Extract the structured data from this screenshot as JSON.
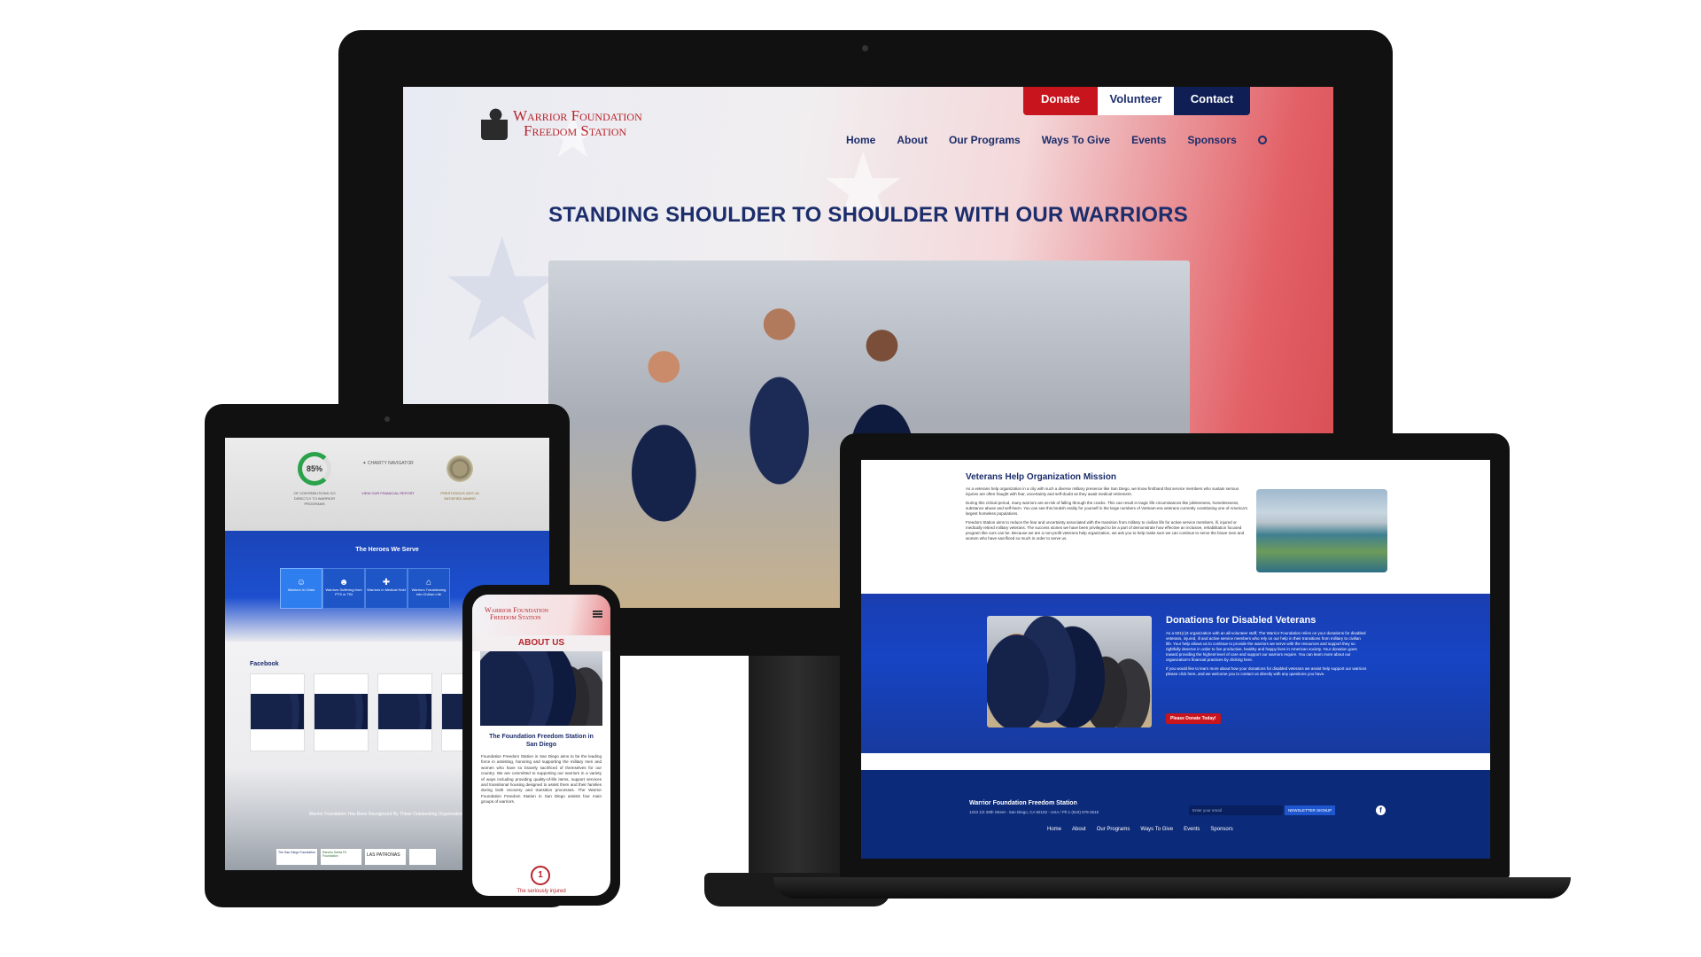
{
  "desktop": {
    "logo_line1": "Warrior Foundation",
    "logo_line2": "Freedom Station",
    "top_buttons": [
      "Donate",
      "Volunteer",
      "Contact"
    ],
    "nav": [
      "Home",
      "About",
      "Our Programs",
      "Ways To Give",
      "Events",
      "Sponsors"
    ],
    "hero_title": "STANDING SHOULDER TO SHOULDER WITH OUR WARRIORS"
  },
  "tablet": {
    "stat_percent": "85%",
    "stat1": "OF CONTRIBUTIONS GO DIRECTLY TO WARRIOR PROGRAMS",
    "stat2": "VIEW OUR FINANCIAL REPORT",
    "stat3": "PRESTIGIOUS 2007-16 SATISFIED AWARD",
    "charity_label": "CHARITY NAVIGATOR",
    "heroes_title": "The Heroes We Serve",
    "heroes_items": [
      "Warriors In Crisis",
      "Warriors Suffering from PTS or TBI",
      "Warriors in Medical Hold",
      "Warriors Transitioning into Civilian Life"
    ],
    "facebook_title": "Facebook",
    "recognized": "Warrior Foundation Has Been Recognized By These Outstanding Organizations",
    "sponsors": [
      "The San Diego Foundation",
      "Rancho Santa Fe Foundation",
      "LAS PATRONAS"
    ]
  },
  "phone": {
    "logo_line1": "Warrior Foundation",
    "logo_line2": "Freedom Station",
    "about_title": "ABOUT US",
    "subtitle": "The Foundation Freedom Station in San Diego",
    "body": "Foundation Freedom Station in San Diego aims to be the leading force in assisting, honoring and supporting the military men and women who have so bravely sacrificed of themselves for our country. We are committed to supporting our warriors in a variety of ways including providing quality-of-life items, support services and transitional housing designed to assist them and their families during both recovery and transition processes. The Warrior Foundation Freedom Station in San Diego assists four main groups of warriors.",
    "step_number": "1",
    "step_label": "The seriously injured"
  },
  "laptop": {
    "mission_title": "Veterans Help Organization Mission",
    "mission_p1": "As a veterans help organization in a city with such a diverse military presence like San Diego, we know firsthand that service members who sustain serious injuries are often fraught with fear, uncertainty and self-doubt as they await medical retirement.",
    "mission_p2": "During this critical period, many warriors are at-risk of falling through the cracks. This can result in tragic life circumstances like joblessness, homelessness, substance abuse and self-harm. You can see this brutish reality for yourself in the large numbers of Vietnam-era veterans currently constituting one of America's largest homeless populations.",
    "mission_p3": "Freedom Station aims to reduce the fear and uncertainty associated with the transition from military to civilian life for active service members, ill, injured or medically retired military veterans. The success stories we have been privileged to be a part of demonstrate how effective an inclusive, rehabilitation focused program like ours can be. Because we are a non-profit veterans help organization, we ask you to help make sure we can continue to serve the brave men and women who have sacrificed so much in order to serve us.",
    "donations_title": "Donations for Disabled Veterans",
    "donations_p1": "As a 501(c)3 organization with an all-volunteer staff, The Warrior Foundation relies on your donations for disabled veterans, injured, ill and active service members who rely on our help in their transitions from military to civilian life. Your help allows us to continue to provide the warriors we serve with the resources and support they so rightfully deserve in order to live productive, healthy and happy lives in American society. Your donation goes toward providing the highest level of care and support our warriors require. You can learn more about our organization's financial practices by clicking here.",
    "donations_p2": "If you would like to learn more about how your donations for disabled veterans we assist help support our warriors please click here, and we welcome you to contact us directly with any questions you have.",
    "donate_button": "Please Donate Today!",
    "footer_name": "Warrior Foundation Freedom Station",
    "footer_address": "1223 1/2 28th Street - San Diego, CA 92102 - USA  /  Ph:1 (619) 578-2615",
    "email_placeholder": "Enter your email",
    "signup_button": "NEWSLETTER SIGNUP",
    "footer_nav": [
      "Home",
      "About",
      "Our Programs",
      "Ways To Give",
      "Events",
      "Sponsors"
    ]
  }
}
